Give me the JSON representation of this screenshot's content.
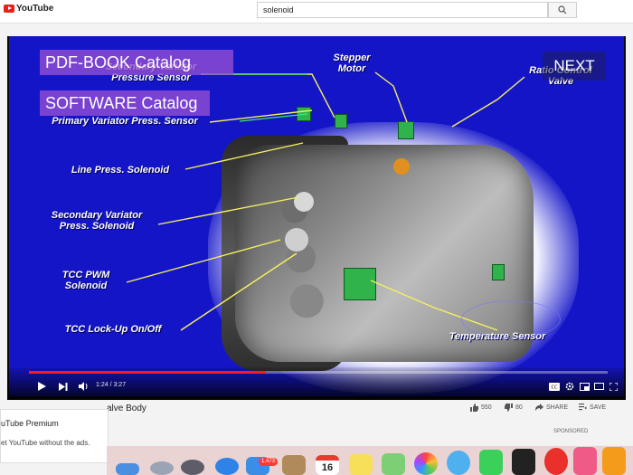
{
  "header": {
    "logo_text": "YouTube",
    "search_value": "solenoid",
    "search_icon": "search-icon"
  },
  "slide": {
    "catalog_buttons": [
      "PDF-BOOK Catalog",
      "SOFTWARE Catalog"
    ],
    "next_label": "NEXT",
    "labels": {
      "secondary_variator_pressure_sensor": "Secondary Variator\nPressure Sensor",
      "stepper_motor": "Stepper\nMotor",
      "ratio_control_valve": "Ratio Control\nValve",
      "primary_variator_press_sensor": "Primary Variator Press. Sensor",
      "line_press_solenoid": "Line Press. Solenoid",
      "secondary_variator_press_solenoid": "Secondary Variator\nPress. Solenoid",
      "tcc_pwm_solenoid": "TCC PWM\nSolenoid",
      "tcc_lockup": "TCC Lock-Up On/Off",
      "temperature_sensor": "Temperature Sensor"
    }
  },
  "player": {
    "time": "1:24 / 3:27",
    "progress": 0.41,
    "accent_color": "#ff1a1a"
  },
  "video": {
    "title_partial": "alve Body",
    "likes": "550",
    "dislikes": "80",
    "share_label": "SHARE",
    "save_label": "SAVE",
    "sponsored_label": "SPONSORED"
  },
  "promo": {
    "title": "uTube Premium",
    "subtitle": "et YouTube without the ads."
  },
  "dock": {
    "mail_badge": "1,473",
    "calendar_day": "16"
  }
}
